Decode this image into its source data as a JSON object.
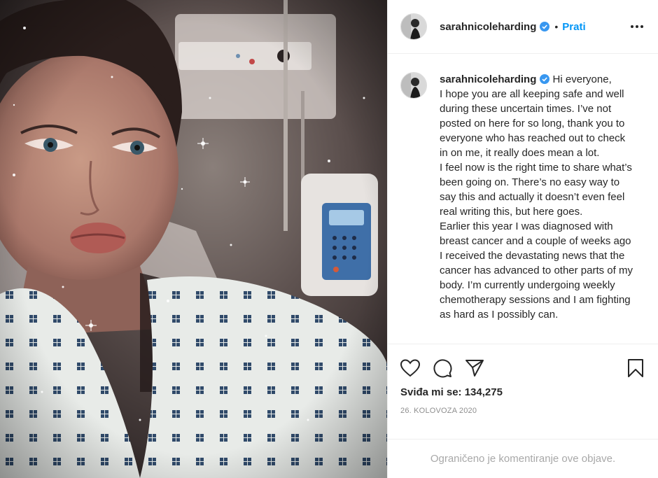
{
  "post": {
    "username": "sarahnicoleharding",
    "follow_label": "Prati",
    "separator": "•",
    "caption_lines": [
      "Hi everyone,",
      "I hope you are all keeping safe and well during these uncertain times. I’ve not posted on here for so long, thank you to everyone who has reached out to check in on me, it really does mean a lot.",
      "I feel now is the right time to share what’s been going on. There’s no easy way to say this and actually it doesn’t even feel real writing this, but here goes.",
      "Earlier this year I was diagnosed with breast cancer and a couple of weeks ago I received the devastating news that the cancer has advanced to other parts of my body. I’m currently undergoing weekly chemotherapy sessions and I am fighting as hard as I possibly can."
    ],
    "likes_text": "Sviđa mi se: 134,275",
    "date": "26. KOLOVOZA 2020",
    "comments_limited": "Ograničeno je komentiranje ove objave."
  },
  "icons": {
    "verified": "verified-badge-icon",
    "more": "more-options-icon",
    "like": "heart-icon",
    "comment": "comment-icon",
    "share": "paper-plane-icon",
    "save": "bookmark-icon"
  },
  "colors": {
    "link_blue": "#0095f6",
    "verified_blue": "#3897f0",
    "text": "#262626",
    "muted": "#8e8e8e",
    "border": "#efefef"
  }
}
